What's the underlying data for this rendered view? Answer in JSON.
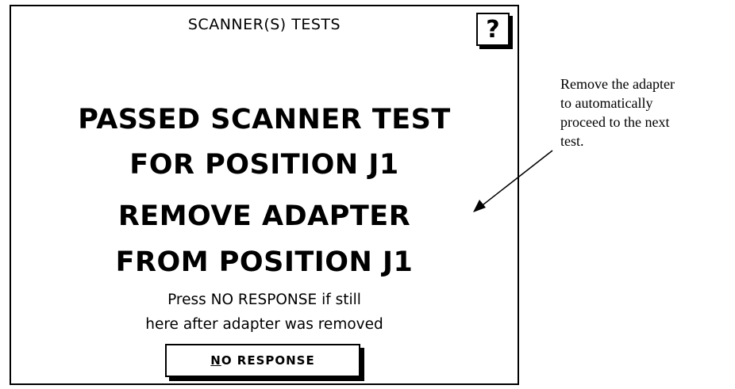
{
  "screen": {
    "title": "SCANNER(S) TESTS",
    "help_label": "?",
    "status_lines": [
      "PASSED SCANNER TEST",
      "FOR POSITION J1"
    ],
    "action_lines": [
      "REMOVE ADAPTER",
      "FROM POSITION J1"
    ],
    "instruction_lines": [
      "Press NO RESPONSE if still",
      "here after adapter was removed"
    ],
    "no_response_button": {
      "mnemonic": "N",
      "rest": "O RESPONSE"
    }
  },
  "annotation": {
    "lines": [
      "Remove the adapter",
      "to automatically",
      "proceed to the next",
      "test."
    ]
  }
}
